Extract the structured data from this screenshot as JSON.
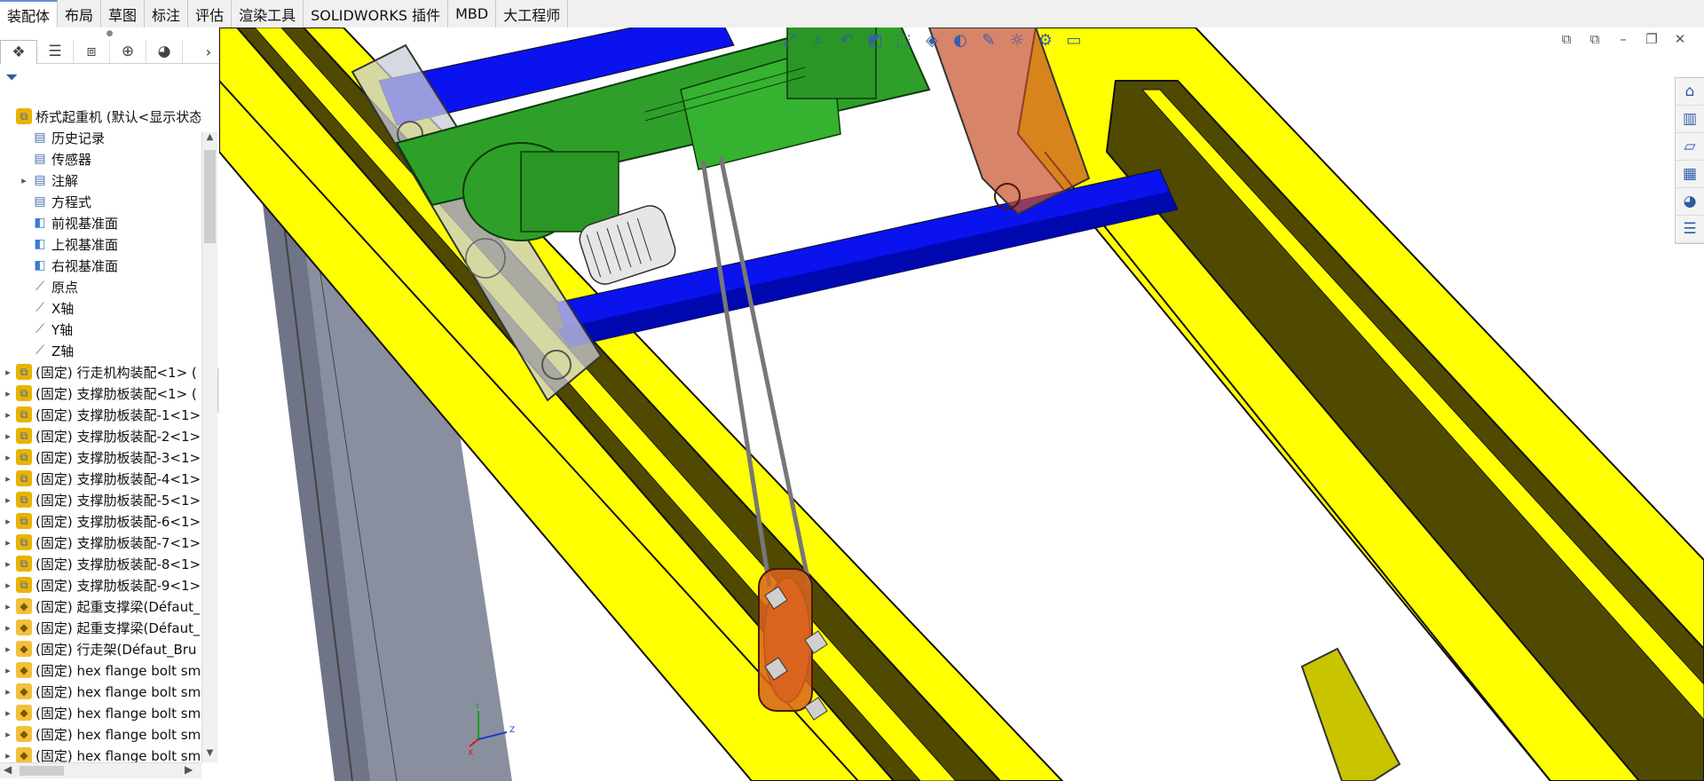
{
  "tabs": [
    "装配体",
    "布局",
    "草图",
    "标注",
    "评估",
    "渲染工具",
    "SOLIDWORKS 插件",
    "MBD",
    "大工程师"
  ],
  "active_tab": "装配体",
  "feature_tree": {
    "root_label": "桥式起重机 (默认<显示状态-",
    "items": [
      {
        "icon": "history-icon",
        "label": "历史记录",
        "expandable": false,
        "kind": "folder"
      },
      {
        "icon": "sensor-icon",
        "label": "传感器",
        "expandable": false,
        "kind": "folder"
      },
      {
        "icon": "annotation-icon",
        "label": "注解",
        "expandable": true,
        "kind": "folder"
      },
      {
        "icon": "equation-icon",
        "label": "方程式",
        "expandable": false,
        "kind": "folder"
      },
      {
        "icon": "plane-icon",
        "label": "前视基准面",
        "expandable": false,
        "kind": "plane"
      },
      {
        "icon": "plane-icon",
        "label": "上视基准面",
        "expandable": false,
        "kind": "plane"
      },
      {
        "icon": "plane-icon",
        "label": "右视基准面",
        "expandable": false,
        "kind": "plane"
      },
      {
        "icon": "origin-icon",
        "label": "原点",
        "expandable": false,
        "kind": "axis"
      },
      {
        "icon": "axis-icon",
        "label": "X轴",
        "expandable": false,
        "kind": "axis"
      },
      {
        "icon": "axis-icon",
        "label": "Y轴",
        "expandable": false,
        "kind": "axis"
      },
      {
        "icon": "axis-icon",
        "label": "Z轴",
        "expandable": false,
        "kind": "axis"
      },
      {
        "icon": "assembly-icon",
        "label": "(固定) 行走机构装配<1> (",
        "expandable": true,
        "kind": "asm"
      },
      {
        "icon": "assembly-icon",
        "label": "(固定) 支撑肋板装配<1> (",
        "expandable": true,
        "kind": "asm"
      },
      {
        "icon": "assembly-icon",
        "label": "(固定) 支撑肋板装配-1<1>",
        "expandable": true,
        "kind": "asm"
      },
      {
        "icon": "assembly-icon",
        "label": "(固定) 支撑肋板装配-2<1>",
        "expandable": true,
        "kind": "asm"
      },
      {
        "icon": "assembly-icon",
        "label": "(固定) 支撑肋板装配-3<1>",
        "expandable": true,
        "kind": "asm"
      },
      {
        "icon": "assembly-icon",
        "label": "(固定) 支撑肋板装配-4<1>",
        "expandable": true,
        "kind": "asm"
      },
      {
        "icon": "assembly-icon",
        "label": "(固定) 支撑肋板装配-5<1>",
        "expandable": true,
        "kind": "asm"
      },
      {
        "icon": "assembly-icon",
        "label": "(固定) 支撑肋板装配-6<1>",
        "expandable": true,
        "kind": "asm"
      },
      {
        "icon": "assembly-icon",
        "label": "(固定) 支撑肋板装配-7<1>",
        "expandable": true,
        "kind": "asm"
      },
      {
        "icon": "assembly-icon",
        "label": "(固定) 支撑肋板装配-8<1>",
        "expandable": true,
        "kind": "asm"
      },
      {
        "icon": "assembly-icon",
        "label": "(固定) 支撑肋板装配-9<1>",
        "expandable": true,
        "kind": "asm"
      },
      {
        "icon": "part-icon",
        "label": "(固定) 起重支撑梁(Défaut_",
        "expandable": true,
        "kind": "part"
      },
      {
        "icon": "part-icon",
        "label": "(固定) 起重支撑梁(Défaut_",
        "expandable": true,
        "kind": "part"
      },
      {
        "icon": "part-icon",
        "label": "(固定) 行走架(Défaut_Bru",
        "expandable": true,
        "kind": "part"
      },
      {
        "icon": "part-icon",
        "label": "(固定) hex flange bolt sm",
        "expandable": true,
        "kind": "part"
      },
      {
        "icon": "part-icon",
        "label": "(固定) hex flange bolt sm",
        "expandable": true,
        "kind": "part"
      },
      {
        "icon": "part-icon",
        "label": "(固定) hex flange bolt sm",
        "expandable": true,
        "kind": "part"
      },
      {
        "icon": "part-icon",
        "label": "(固定) hex flange bolt sm",
        "expandable": true,
        "kind": "part"
      },
      {
        "icon": "part-icon",
        "label": "(固定) hex flange bolt sm",
        "expandable": true,
        "kind": "part"
      }
    ]
  },
  "manager_tabs": [
    "feature-manager-icon",
    "property-manager-icon",
    "configuration-manager-icon",
    "dimxpert-icon",
    "display-manager-icon"
  ],
  "heads_up_icons": [
    "zoom-to-fit-icon",
    "zoom-area-icon",
    "previous-view-icon",
    "section-view-icon",
    "view-orientation-icon",
    "display-style-icon",
    "hide-show-icon",
    "edit-appearance-icon",
    "apply-scene-icon",
    "view-settings-icon",
    "display-pane-icon"
  ],
  "task_pane_icons": [
    "home-icon",
    "design-library-icon",
    "file-explorer-icon",
    "view-palette-icon",
    "appearances-icon",
    "custom-properties-icon"
  ],
  "triad_labels": {
    "x": "X",
    "y": "Y",
    "z": "Z"
  },
  "colors": {
    "rail_yellow": "#ffff00",
    "rail_dark": "#4f4a00",
    "crossbar_blue": "#0a12ee",
    "hoist_green": "#2ea02a",
    "end_carriage_red": "#c8502a",
    "hook_orange": "#d9641e",
    "column_gray": "#8a8fa0"
  }
}
